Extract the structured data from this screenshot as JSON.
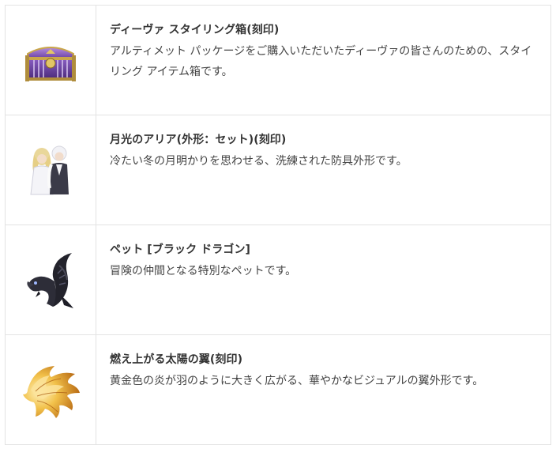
{
  "items": [
    {
      "icon": "treasure-chest-icon",
      "title": "ディーヴァ スタイリング箱(刻印)",
      "description": "アルティメット パッケージをご購入いただいたディーヴァの皆さんのための、スタイリング アイテム箱です。"
    },
    {
      "icon": "couple-costume-icon",
      "title": "月光のアリア(外形：セット)(刻印)",
      "description": "冷たい冬の月明かりを思わせる、洗練された防具外形です。"
    },
    {
      "icon": "black-dragon-pet-icon",
      "title": "ペット [ブラック ドラゴン]",
      "description": "冒険の仲間となる特別なペットです。"
    },
    {
      "icon": "flaming-wings-icon",
      "title": "燃え上がる太陽の翼(刻印)",
      "description": "黄金色の炎が羽のように大きく広がる、華やかなビジュアルの翼外形です。"
    }
  ]
}
